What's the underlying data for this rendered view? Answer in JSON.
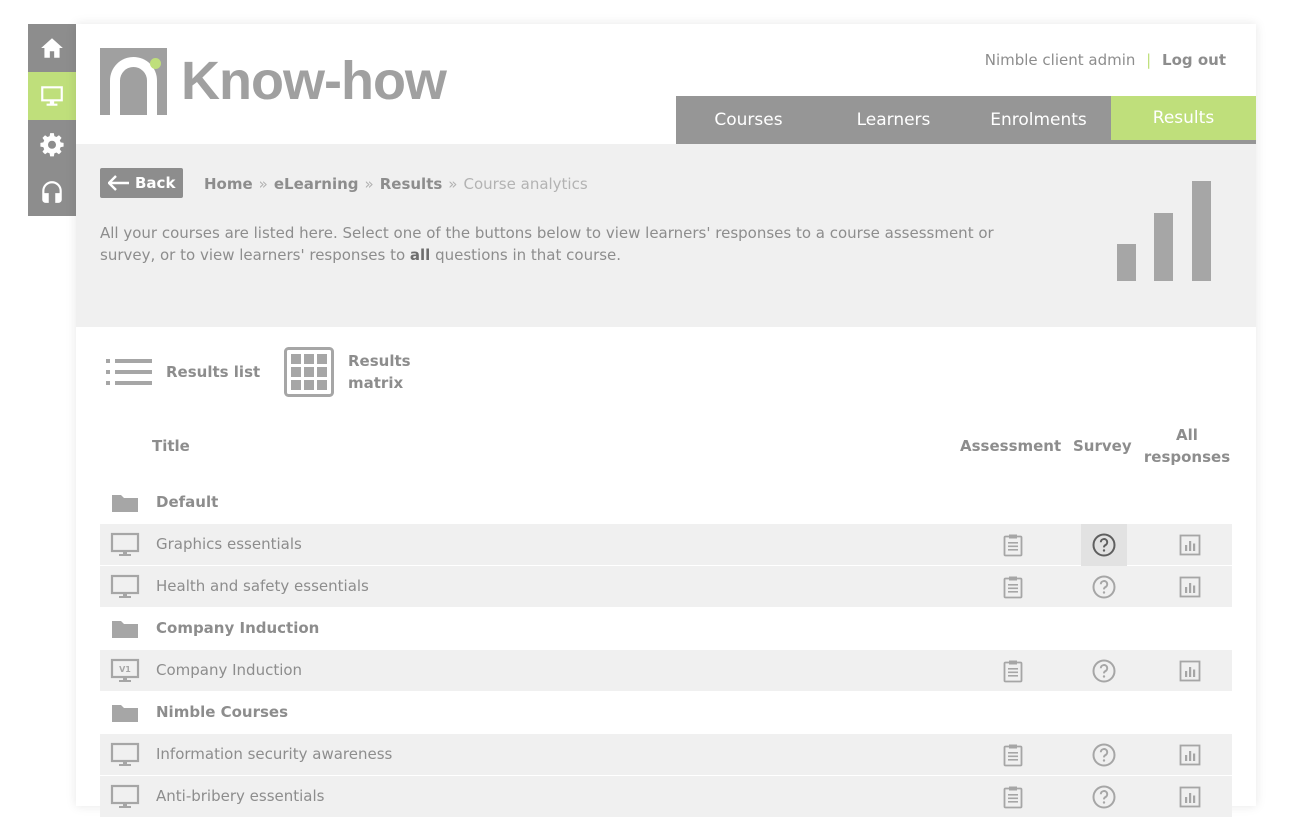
{
  "sidebar": {
    "items": [
      {
        "icon": "home-icon"
      },
      {
        "icon": "monitor-icon",
        "active": true
      },
      {
        "icon": "gear-icon"
      },
      {
        "icon": "headset-icon"
      }
    ]
  },
  "header": {
    "logo_text": "Know-how",
    "user_name": "Nimble client admin",
    "separator": "|",
    "logout_label": "Log out"
  },
  "nav": {
    "tabs": [
      {
        "label": "Courses"
      },
      {
        "label": "Learners"
      },
      {
        "label": "Enrolments"
      },
      {
        "label": "Results",
        "active": true
      }
    ]
  },
  "banner": {
    "back_label": "Back",
    "breadcrumb": {
      "home": "Home",
      "elearning": "eLearning",
      "results": "Results",
      "current": "Course analytics",
      "separator": "»"
    },
    "intro_start": "All your courses are listed here. Select one of the buttons below to view learners' responses to a course assessment or survey, or to view learners' responses to ",
    "intro_bold": "all",
    "intro_end": " questions in that course.",
    "chart_icon": "bar-chart-icon"
  },
  "views": {
    "list_label": "Results list",
    "matrix_label_line1": "Results",
    "matrix_label_line2": "matrix"
  },
  "table": {
    "headers": {
      "title": "Title",
      "assessment": "Assessment",
      "survey": "Survey",
      "all_line1": "All",
      "all_line2": "responses"
    },
    "rows": [
      {
        "type": "group",
        "name": "Default"
      },
      {
        "type": "course",
        "name": "Graphics essentials",
        "icon": "monitor-icon"
      },
      {
        "type": "course",
        "name": "Health and safety essentials",
        "icon": "monitor-icon"
      },
      {
        "type": "group",
        "name": "Company Induction"
      },
      {
        "type": "course",
        "name": "Company Induction",
        "icon": "monitor-v1-icon",
        "version": "V1"
      },
      {
        "type": "group",
        "name": "Nimble Courses"
      },
      {
        "type": "course",
        "name": "Information security awareness",
        "icon": "monitor-icon"
      },
      {
        "type": "course",
        "name": "Anti-bribery essentials",
        "icon": "monitor-icon"
      }
    ]
  },
  "colors": {
    "accent": "#bfdf7b",
    "nav_gray": "#969696",
    "sidebar_gray": "#8d8d8d",
    "row_bg": "#f0f0f0",
    "text": "#8d8d8d"
  }
}
